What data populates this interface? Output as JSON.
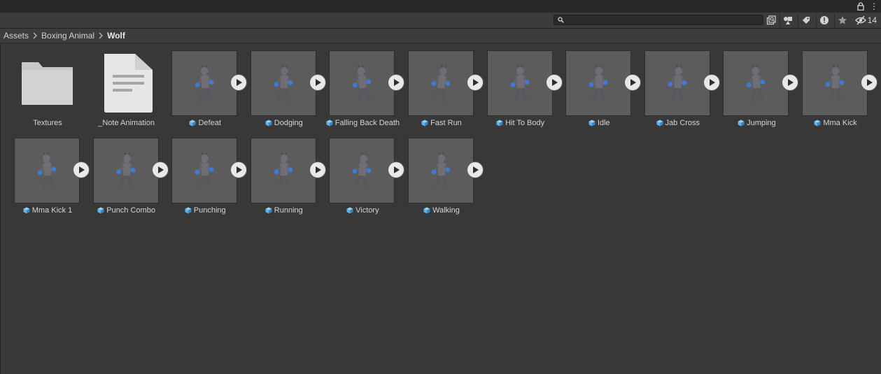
{
  "toolbar": {
    "search": {
      "value": "",
      "placeholder": ""
    },
    "hidden_packages_count": "14"
  },
  "breadcrumb": [
    "Assets",
    "Boxing Animal",
    "Wolf"
  ],
  "items": [
    {
      "label": "Textures",
      "kind": "folder"
    },
    {
      "label": "_Note Animation",
      "kind": "document"
    },
    {
      "label": "Defeat",
      "kind": "animation"
    },
    {
      "label": "Dodging",
      "kind": "animation"
    },
    {
      "label": "Falling Back Death",
      "kind": "animation"
    },
    {
      "label": "Fast Run",
      "kind": "animation"
    },
    {
      "label": "Hit To Body",
      "kind": "animation"
    },
    {
      "label": "Idle",
      "kind": "animation"
    },
    {
      "label": "Jab Cross",
      "kind": "animation"
    },
    {
      "label": "Jumping",
      "kind": "animation"
    },
    {
      "label": "Mma Kick",
      "kind": "animation"
    },
    {
      "label": "Mma Kick 1",
      "kind": "animation"
    },
    {
      "label": "Punch Combo",
      "kind": "animation"
    },
    {
      "label": "Punching",
      "kind": "animation"
    },
    {
      "label": "Running",
      "kind": "animation"
    },
    {
      "label": "Victory",
      "kind": "animation"
    },
    {
      "label": "Walking",
      "kind": "animation"
    }
  ],
  "colors": {
    "background": "#383838",
    "thumbnail_bg": "#5c5c5c",
    "character_body": "#6e6e74",
    "glove_blue": "#3f7ad6",
    "cube_icon": "#5fb4ea"
  },
  "icons": {
    "folder": "folder-icon",
    "document": "document-icon",
    "animation_clip": "cube-icon",
    "play": "play-icon"
  }
}
